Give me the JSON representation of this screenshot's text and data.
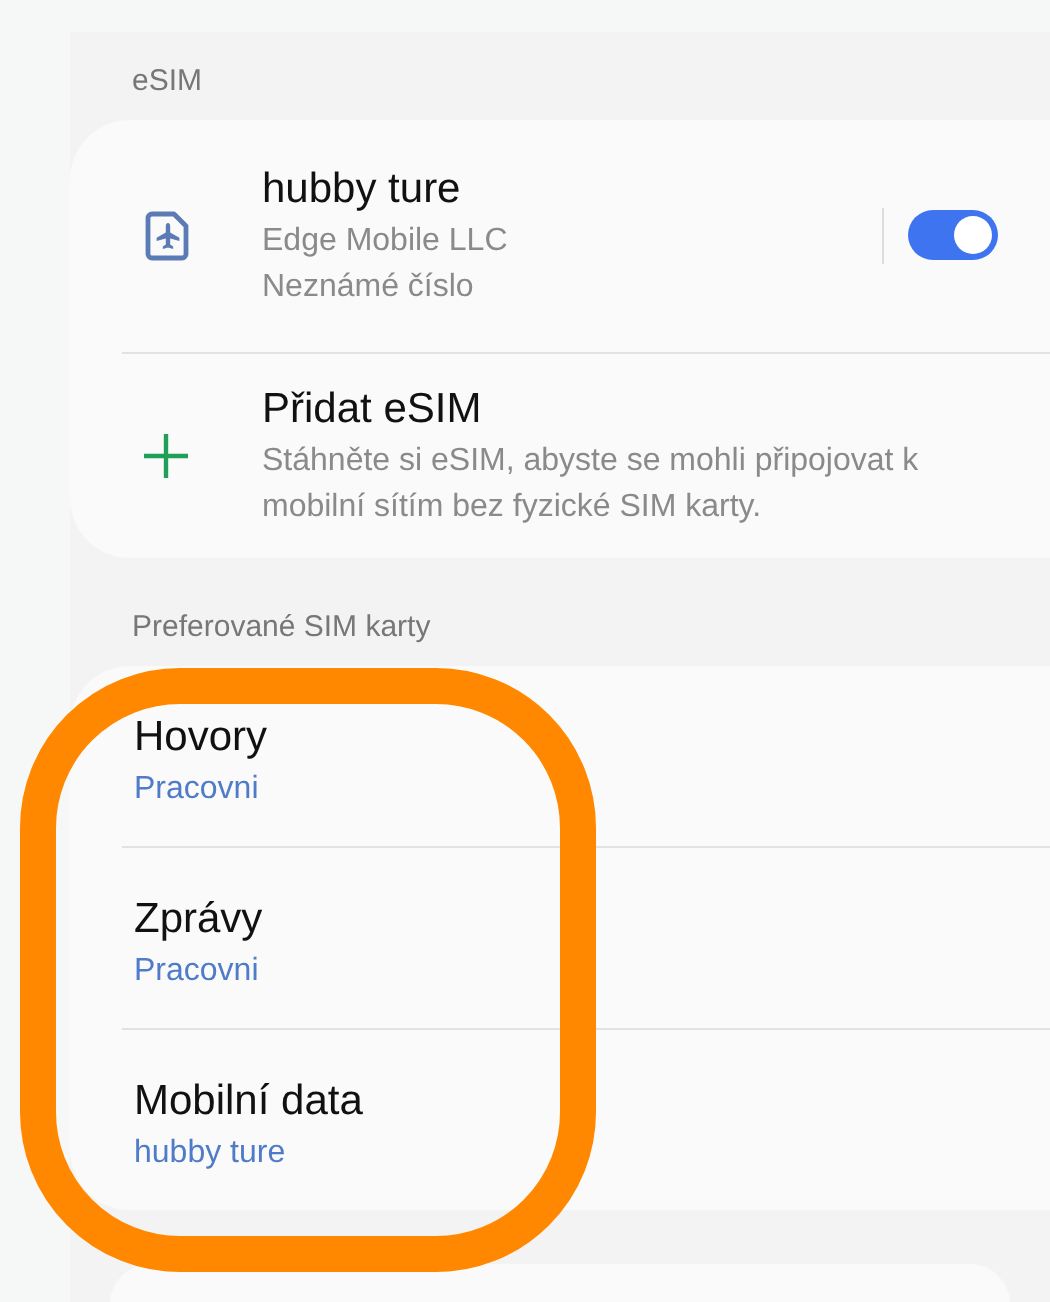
{
  "esim_section": {
    "header": "eSIM",
    "items": [
      {
        "kind": "sim",
        "title": "hubby ture",
        "lines": [
          "Edge Mobile LLC",
          "Neznámé číslo"
        ],
        "on": true
      },
      {
        "kind": "add",
        "title": "Přidat eSIM",
        "lines": [
          "Stáhněte si eSIM, abyste se mohli připojovat k mobilní sítím bez fyzické SIM karty."
        ]
      }
    ]
  },
  "preferred_section": {
    "header": "Preferované SIM karty",
    "items": [
      {
        "title": "Hovory",
        "value": "Pracovni"
      },
      {
        "title": "Zprávy",
        "value": "Pracovni"
      },
      {
        "title": "Mobilní data",
        "value": "hubby ture"
      }
    ]
  }
}
